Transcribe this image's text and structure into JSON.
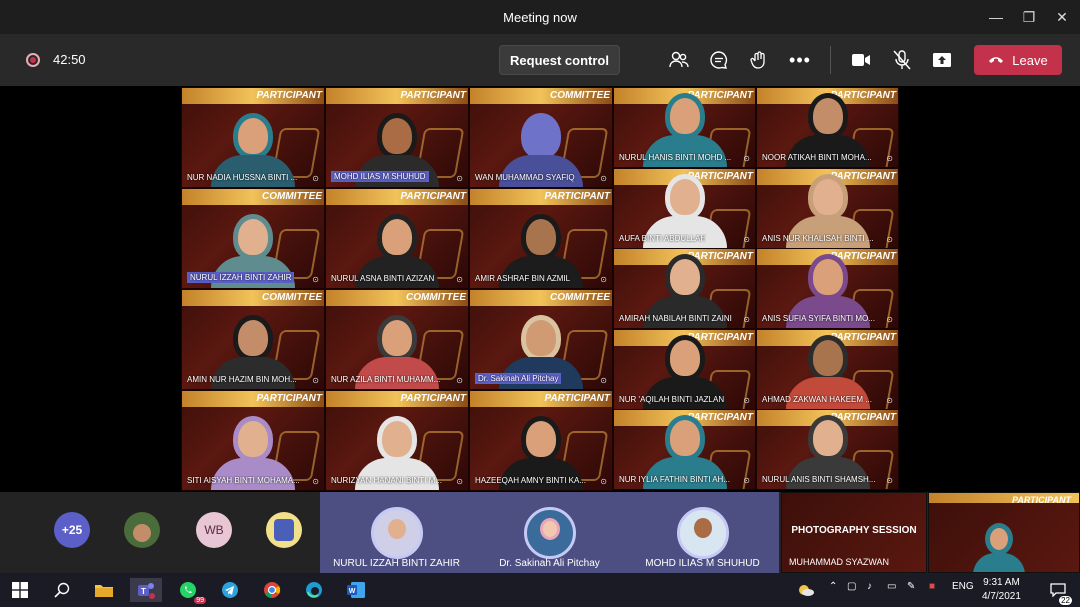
{
  "window": {
    "title": "Meeting now"
  },
  "toolbar": {
    "timer": "42:50",
    "request_control": "Request control",
    "leave": "Leave"
  },
  "tiles_left": [
    {
      "name": "NUR NADIA HUSSNA BINTI ...",
      "banner": "PARTICIPANT",
      "highlight": false,
      "skin": "#d9a07a",
      "hijab": "#2a7d8c",
      "shirt": "#2a5d6e"
    },
    {
      "name": "MOHD ILIAS M SHUHUD",
      "banner": "PARTICIPANT",
      "highlight": true,
      "skin": "#a96c45",
      "hijab": "#1a1a1a",
      "shirt": "#2b2b2b"
    },
    {
      "name": "WAN MUHAMMAD SYAFIQ",
      "banner": "COMMITTEE",
      "highlight": false,
      "skin": "#6e73c9",
      "hijab": "#6e73c9",
      "shirt": "#4a4f9a"
    },
    {
      "name": "NURUL IZZAH BINTI ZAHIR",
      "banner": "COMMITTEE",
      "highlight": true,
      "skin": "#e0b08f",
      "hijab": "#5e8c8f",
      "shirt": "#5e8c8f"
    },
    {
      "name": "NURUL ASNA BINTI AZIZAN",
      "banner": "PARTICIPANT",
      "highlight": false,
      "skin": "#d9a07a",
      "hijab": "#222222",
      "shirt": "#222222"
    },
    {
      "name": "AMIR ASHRAF BIN AZMIL",
      "banner": "PARTICIPANT",
      "highlight": false,
      "skin": "#a8744e",
      "hijab": "#1a1a1a",
      "shirt": "#1c1c1c"
    },
    {
      "name": "AMIN NUR HAZIM BIN MOH...",
      "banner": "COMMITTEE",
      "highlight": false,
      "skin": "#c28d68",
      "hijab": "#1a1a1a",
      "shirt": "#2c2c2c"
    },
    {
      "name": "NUR AZILA BINTI MUHAMM...",
      "banner": "COMMITTEE",
      "highlight": false,
      "skin": "#d9a07a",
      "hijab": "#3a3a3a",
      "shirt": "#c24a4a"
    },
    {
      "name": "Dr. Sakinah Ali Pitchay",
      "banner": "COMMITTEE",
      "highlight": true,
      "skin": "#d09a72",
      "hijab": "#d9c3a0",
      "shirt": "#1f3a5c"
    },
    {
      "name": "SITI AISYAH BINTI MOHAMA...",
      "banner": "PARTICIPANT",
      "highlight": false,
      "skin": "#e0b08f",
      "hijab": "#a98cc7",
      "shirt": "#a98cc7"
    },
    {
      "name": "NURIZYAN HANANI BINTI M...",
      "banner": "PARTICIPANT",
      "highlight": false,
      "skin": "#e0b08f",
      "hijab": "#e5e5e5",
      "shirt": "#e5e5e5"
    },
    {
      "name": "HAZEEQAH AMNY BINTI KA...",
      "banner": "PARTICIPANT",
      "highlight": false,
      "skin": "#d9a07a",
      "hijab": "#1a1a1a",
      "shirt": "#1a1a1a"
    }
  ],
  "tiles_right": [
    {
      "name": "NURUL HANIS BINTI MOHD ...",
      "banner": "PARTICIPANT",
      "skin": "#d9a07a",
      "hijab": "#2a7d8c",
      "shirt": "#2a7d8c"
    },
    {
      "name": "NOOR ATIKAH BINTI MOHA...",
      "banner": "PARTICIPANT",
      "skin": "#c28d68",
      "hijab": "#1a1a1a",
      "shirt": "#1a1a1a"
    },
    {
      "name": "AUFA BINTI ABDULLAH",
      "banner": "PARTICIPANT",
      "skin": "#e0b08f",
      "hijab": "#e5e5e5",
      "shirt": "#e5e5e5"
    },
    {
      "name": "ANIS NUR KHALISAH BINTI ...",
      "banner": "PARTICIPANT",
      "skin": "#e0b08f",
      "hijab": "#c7a07a",
      "shirt": "#c7a07a"
    },
    {
      "name": "AMIRAH NABILAH BINTI ZAINI",
      "banner": "PARTICIPANT",
      "skin": "#e0b08f",
      "hijab": "#2a2a2a",
      "shirt": "#2a2a2a"
    },
    {
      "name": "ANIS SUFIA SYIFA BINTI MO...",
      "banner": "PARTICIPANT",
      "skin": "#d9a07a",
      "hijab": "#7a4a8c",
      "shirt": "#7a4a8c"
    },
    {
      "name": "NUR 'AQILAH BINTI JAZLAN",
      "banner": "PARTICIPANT",
      "skin": "#d9a07a",
      "hijab": "#1a1a1a",
      "shirt": "#1a1a1a"
    },
    {
      "name": "AHMAD ZAKWAN HAKEEM ...",
      "banner": "PARTICIPANT",
      "skin": "#a8744e",
      "hijab": "#2c2c2c",
      "shirt": "#c24a3a"
    },
    {
      "name": "NUR IYLIA FATHIN BINTI AH...",
      "banner": "PARTICIPANT",
      "skin": "#d9a07a",
      "hijab": "#2a7d8c",
      "shirt": "#2a7d8c"
    },
    {
      "name": "NURUL ANIS BINTI SHAMSH...",
      "banner": "PARTICIPANT",
      "skin": "#e0b08f",
      "hijab": "#3a3a3a",
      "shirt": "#3a3a3a"
    }
  ],
  "bottom": {
    "overflow_count": "+25",
    "wb_initials": "WB",
    "pinned": [
      {
        "name": "NURUL IZZAH BINTI ZAHIR"
      },
      {
        "name": "Dr. Sakinah Ali Pitchay"
      },
      {
        "name": "MOHD ILIAS M SHUHUD"
      }
    ],
    "thumb1": {
      "title": "PHOTOGRAPHY SESSION",
      "name": "MUHAMMAD SYAZWAN"
    },
    "thumb2": {
      "banner": "PARTICIPANT"
    }
  },
  "taskbar": {
    "whatsapp_badge": "99",
    "lang": "ENG",
    "time": "9:31 AM",
    "date": "4/7/2021",
    "notif_count": "22"
  },
  "colors": {
    "leave": "#c4314b",
    "toolbar": "#292929",
    "pinned_bg": "#4d4f82",
    "name_highlight": "#5b5fc7"
  }
}
